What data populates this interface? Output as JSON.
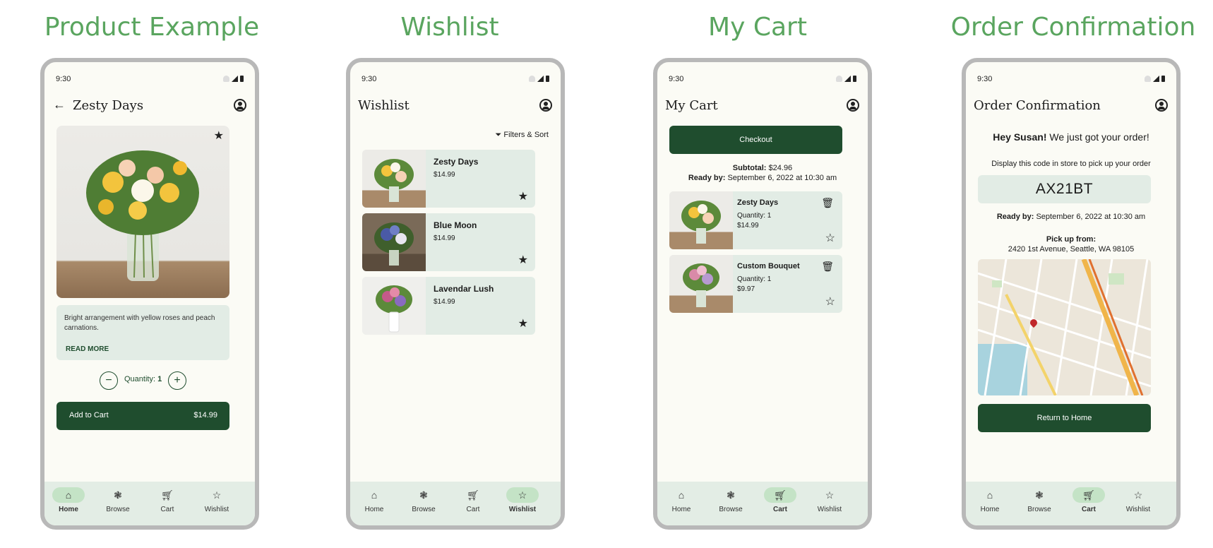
{
  "headings": {
    "product": "Product Example",
    "wishlist": "Wishlist",
    "cart": "My Cart",
    "confirmation": "Order Confirmation"
  },
  "status": {
    "time": "9:30"
  },
  "nav": {
    "home": "Home",
    "browse": "Browse",
    "cart": "Cart",
    "wishlist": "Wishlist"
  },
  "product": {
    "title": "Zesty Days",
    "description": "Bright arrangement with yellow roses and peach carnations.",
    "read_more": "READ MORE",
    "quantity_label": "Quantity:",
    "quantity_value": "1",
    "add_to_cart": "Add to Cart",
    "price": "$14.99"
  },
  "wishlist": {
    "title": "Wishlist",
    "filters": "Filters & Sort",
    "items": [
      {
        "name": "Zesty Days",
        "price": "$14.99"
      },
      {
        "name": "Blue Moon",
        "price": "$14.99"
      },
      {
        "name": "Lavendar Lush",
        "price": "$14.99"
      }
    ]
  },
  "cart": {
    "title": "My Cart",
    "checkout": "Checkout",
    "subtotal_label": "Subtotal:",
    "subtotal_value": "$24.96",
    "ready_label": "Ready by:",
    "ready_value": "September 6, 2022 at 10:30 am",
    "items": [
      {
        "name": "Zesty Days",
        "quantity": "Quantity: 1",
        "price": "$14.99"
      },
      {
        "name": "Custom Bouquet",
        "quantity": "Quantity: 1",
        "price": "$9.97"
      }
    ]
  },
  "confirmation": {
    "title": "Order Confirmation",
    "greeting_name": "Hey Susan!",
    "greeting_text": " We just got your order!",
    "instructions": "Display this code in store to pick up your order",
    "code": "AX21BT",
    "ready_label": "Ready by:",
    "ready_value": "September 6, 2022 at 10:30 am",
    "pickup_label": "Pick up from:",
    "pickup_address": "2420 1st Avenue, Seattle, WA 98105",
    "return_home": "Return to Home"
  },
  "colors": {
    "accent": "#1f4d2e",
    "heading": "#5aa55f",
    "card": "#e2ece5",
    "nav": "#e3ede5"
  }
}
